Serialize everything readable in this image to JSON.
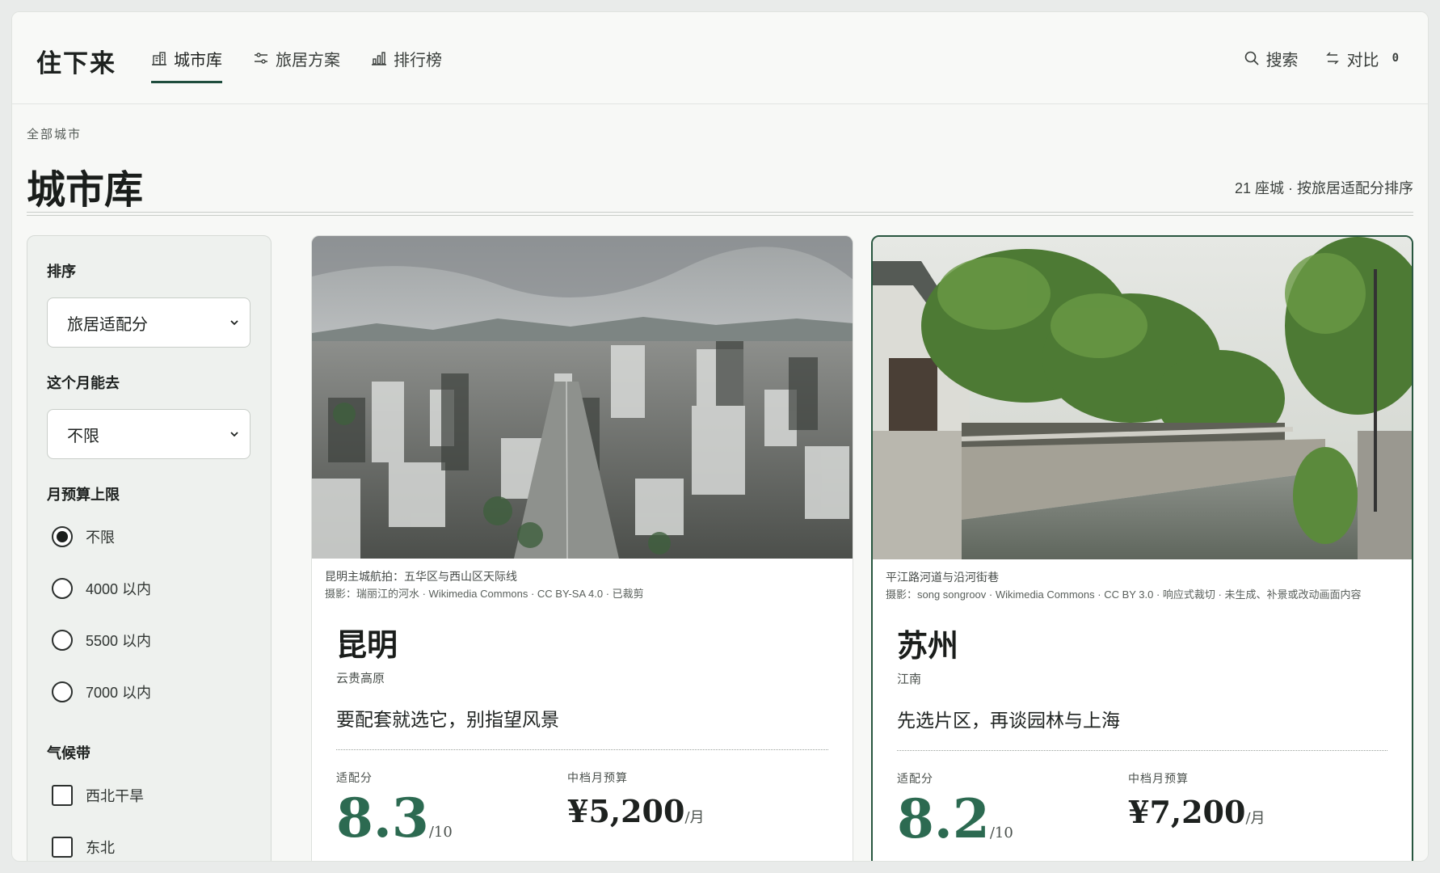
{
  "brand": "住下来",
  "nav": {
    "items": [
      {
        "label": "城市库",
        "icon": "building-icon",
        "active": true
      },
      {
        "label": "旅居方案",
        "icon": "sliders-icon",
        "active": false
      },
      {
        "label": "排行榜",
        "icon": "bar-chart-icon",
        "active": false
      }
    ]
  },
  "actions": {
    "search_label": "搜索",
    "compare_label": "对比",
    "compare_count": "0"
  },
  "page": {
    "breadcrumb": "全部城市",
    "title": "城市库",
    "summary": "21 座城 · 按旅居适配分排序"
  },
  "filters": {
    "sort": {
      "label": "排序",
      "value": "旅居适配分"
    },
    "month": {
      "label": "这个月能去",
      "value": "不限"
    },
    "budget": {
      "label": "月预算上限",
      "options": [
        {
          "label": "不限",
          "selected": true
        },
        {
          "label": "4000 以内",
          "selected": false
        },
        {
          "label": "5500 以内",
          "selected": false
        },
        {
          "label": "7000 以内",
          "selected": false
        }
      ]
    },
    "climate": {
      "label": "气候带",
      "options": [
        {
          "label": "西北干旱",
          "checked": false
        },
        {
          "label": "东北",
          "checked": false
        }
      ]
    }
  },
  "cities": [
    {
      "caption": "昆明主城航拍：五华区与西山区天际线",
      "credit": "摄影：瑞丽江的河水 · Wikimedia Commons · CC BY-SA 4.0 · 已裁剪",
      "name": "昆明",
      "region": "云贵高原",
      "tagline": "要配套就选它，别指望风景",
      "score_label": "适配分",
      "score": "8.3",
      "score_unit": "/10",
      "budget_label": "中档月预算",
      "budget": "¥5,200",
      "budget_unit": "/月"
    },
    {
      "caption": "平江路河道与沿河街巷",
      "credit": "摄影：song songroov · Wikimedia Commons · CC BY 3.0 · 响应式裁切 · 未生成、补景或改动画面内容",
      "name": "苏州",
      "region": "江南",
      "tagline": "先选片区，再谈园林与上海",
      "score_label": "适配分",
      "score": "8.2",
      "score_unit": "/10",
      "budget_label": "中档月预算",
      "budget": "¥7,200",
      "budget_unit": "/月"
    }
  ],
  "colors": {
    "accent": "#2c6a51",
    "selected_border": "#28563f"
  }
}
